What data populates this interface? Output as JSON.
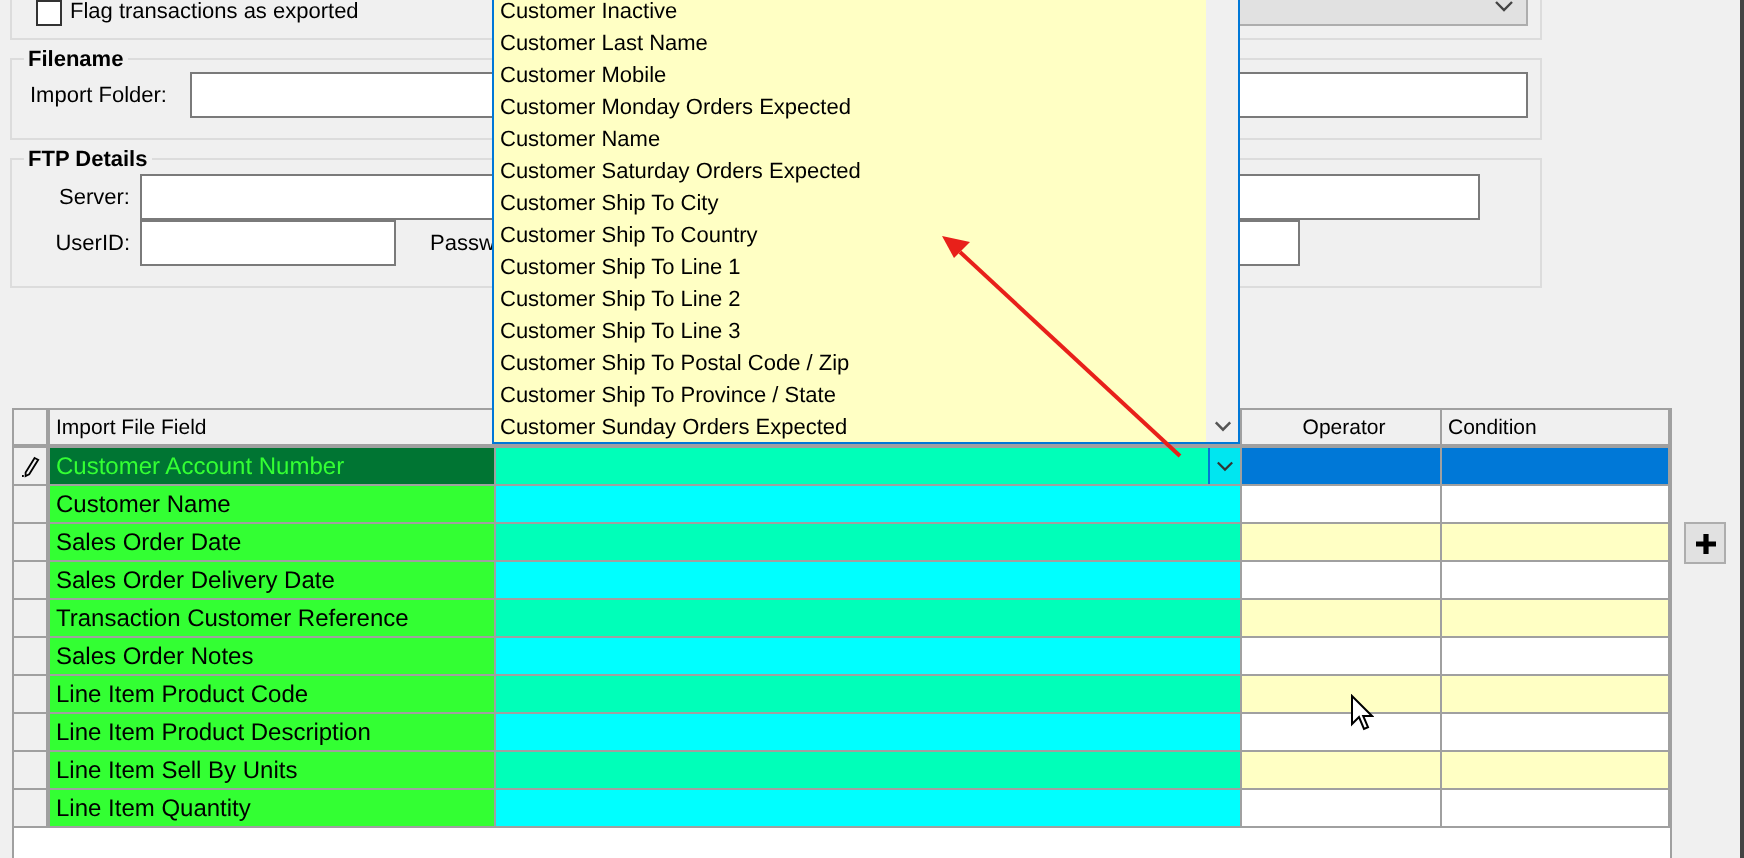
{
  "options_group": {
    "checkbox": {
      "label": "Flag transactions as exported",
      "checked": false
    }
  },
  "filename_group": {
    "title": "Filename",
    "import_folder_label": "Import Folder:"
  },
  "ftp_group": {
    "title": "FTP Details",
    "server_label": "Server:",
    "userid_label": "UserID:",
    "password_label": "Passw"
  },
  "grid": {
    "columns": [
      "Import File Field",
      "Operator",
      "Condition"
    ],
    "rows": [
      {
        "field": "Customer Account Number",
        "selected": true
      },
      {
        "field": "Customer Name",
        "selected": false
      },
      {
        "field": "Sales Order Date",
        "selected": false
      },
      {
        "field": "Sales Order Delivery Date",
        "selected": false
      },
      {
        "field": "Transaction Customer Reference",
        "selected": false
      },
      {
        "field": "Sales Order Notes",
        "selected": false
      },
      {
        "field": "Line Item Product Code",
        "selected": false
      },
      {
        "field": "Line Item Product Description",
        "selected": false
      },
      {
        "field": "Line Item Sell By Units",
        "selected": false
      },
      {
        "field": "Line Item Quantity",
        "selected": false
      }
    ]
  },
  "dropdown_list": {
    "items": [
      "Customer Inactive",
      "Customer Last Name",
      "Customer Mobile",
      "Customer Monday Orders Expected",
      "Customer Name",
      "Customer Saturday Orders Expected",
      "Customer Ship To City",
      "Customer Ship To Country",
      "Customer Ship To Line 1",
      "Customer Ship To Line 2",
      "Customer Ship To Line 3",
      "Customer Ship To Postal Code / Zip",
      "Customer Ship To Province / State",
      "Customer Sunday Orders Expected"
    ]
  }
}
